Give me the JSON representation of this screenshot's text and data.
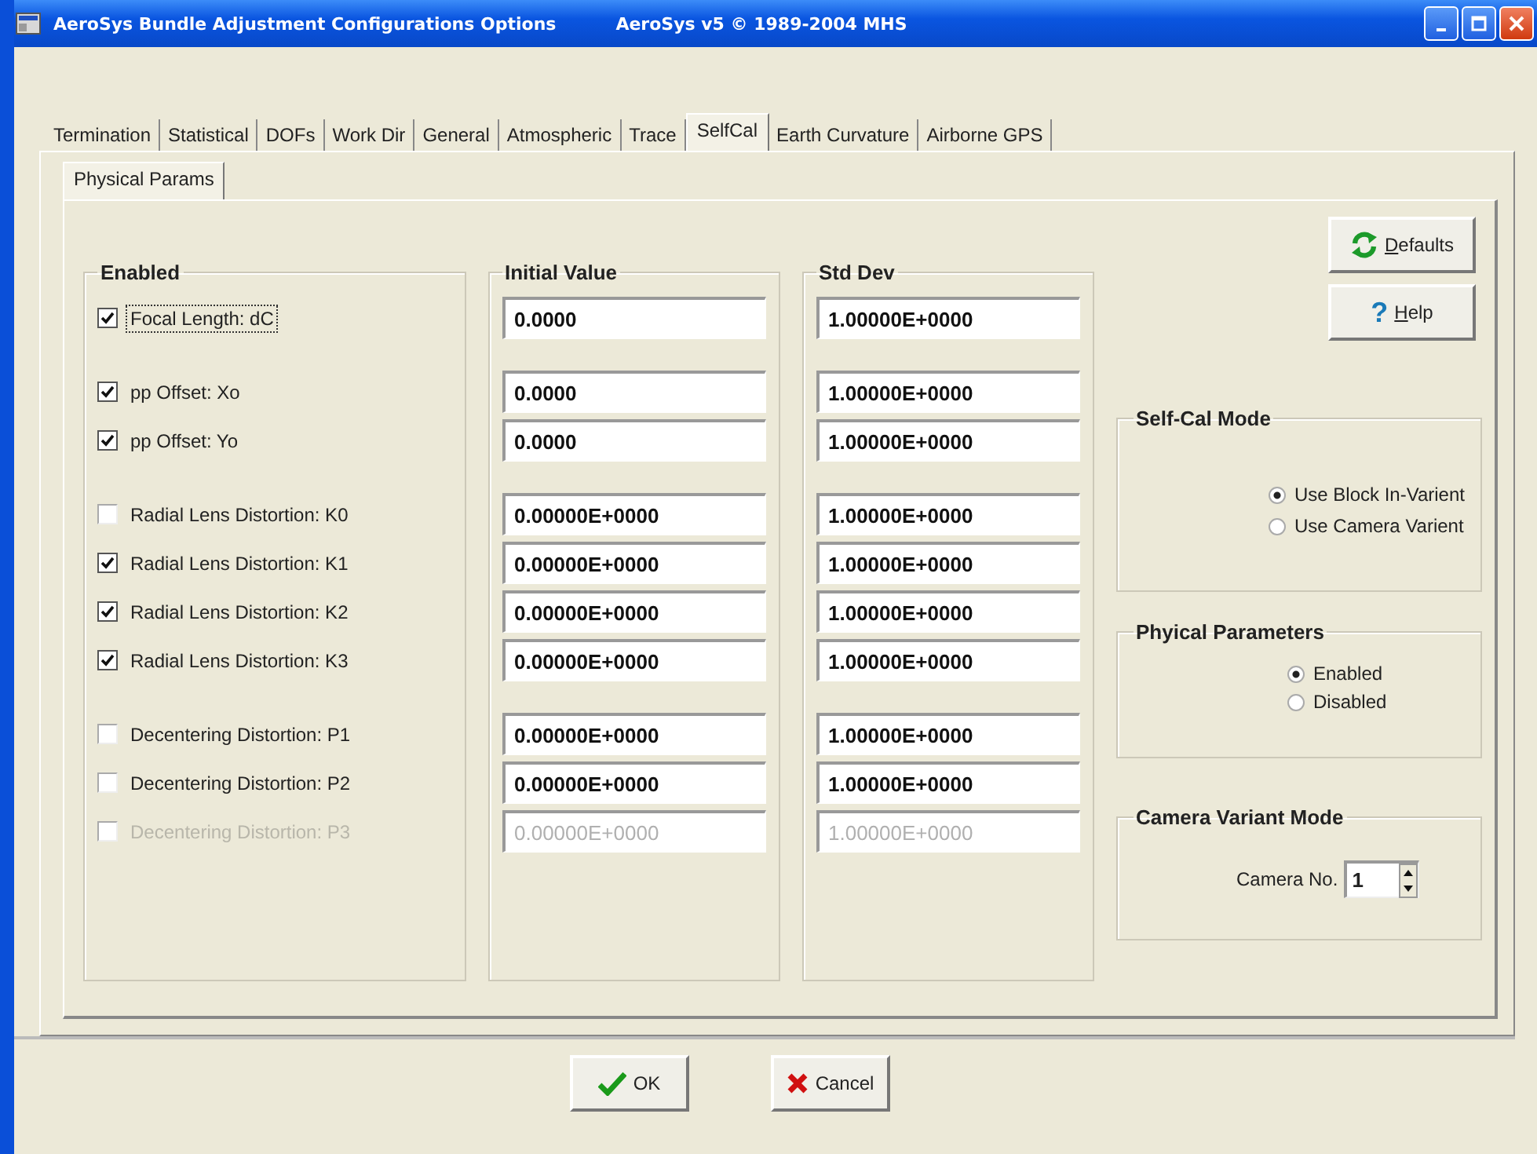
{
  "window": {
    "title": "AeroSys Bundle Adjustment Configurations Options",
    "subtitle": "AeroSys v5 © 1989-2004 MHS"
  },
  "tabs": [
    {
      "label": "Termination",
      "selected": false
    },
    {
      "label": "Statistical",
      "selected": false
    },
    {
      "label": "DOFs",
      "selected": false
    },
    {
      "label": "Work Dir",
      "selected": false
    },
    {
      "label": "General",
      "selected": false
    },
    {
      "label": "Atmospheric",
      "selected": false
    },
    {
      "label": "Trace",
      "selected": false
    },
    {
      "label": "SelfCal",
      "selected": true
    },
    {
      "label": "Earth Curvature",
      "selected": false
    },
    {
      "label": "Airborne GPS",
      "selected": false
    }
  ],
  "subtabs": [
    {
      "label": "Physical Params",
      "selected": true
    }
  ],
  "columns": {
    "enabled": "Enabled",
    "initial_value": "Initial Value",
    "std_dev": "Std Dev"
  },
  "parameter_groups": [
    {
      "parameters": [
        {
          "label": "Focal Length: dC",
          "checked": true,
          "disabled": false,
          "focused": true,
          "initial_value": "0.0000",
          "std_dev": "1.00000E+0000"
        }
      ]
    },
    {
      "parameters": [
        {
          "label": "pp Offset: Xo",
          "checked": true,
          "disabled": false,
          "focused": false,
          "initial_value": "0.0000",
          "std_dev": "1.00000E+0000"
        },
        {
          "label": "pp Offset: Yo",
          "checked": true,
          "disabled": false,
          "focused": false,
          "initial_value": "0.0000",
          "std_dev": "1.00000E+0000"
        }
      ]
    },
    {
      "parameters": [
        {
          "label": "Radial Lens Distortion: K0",
          "checked": false,
          "disabled": false,
          "focused": false,
          "initial_value": "0.00000E+0000",
          "std_dev": "1.00000E+0000"
        },
        {
          "label": "Radial Lens Distortion: K1",
          "checked": true,
          "disabled": false,
          "focused": false,
          "initial_value": "0.00000E+0000",
          "std_dev": "1.00000E+0000"
        },
        {
          "label": "Radial Lens Distortion: K2",
          "checked": true,
          "disabled": false,
          "focused": false,
          "initial_value": "0.00000E+0000",
          "std_dev": "1.00000E+0000"
        },
        {
          "label": "Radial Lens Distortion: K3",
          "checked": true,
          "disabled": false,
          "focused": false,
          "initial_value": "0.00000E+0000",
          "std_dev": "1.00000E+0000"
        }
      ]
    },
    {
      "parameters": [
        {
          "label": "Decentering Distortion: P1",
          "checked": false,
          "disabled": false,
          "focused": false,
          "initial_value": "0.00000E+0000",
          "std_dev": "1.00000E+0000"
        },
        {
          "label": "Decentering Distortion: P2",
          "checked": false,
          "disabled": false,
          "focused": false,
          "initial_value": "0.00000E+0000",
          "std_dev": "1.00000E+0000"
        },
        {
          "label": "Decentering Distortion: P3",
          "checked": false,
          "disabled": true,
          "focused": false,
          "initial_value": "0.00000E+0000",
          "std_dev": "1.00000E+0000"
        }
      ]
    }
  ],
  "side_buttons": [
    {
      "label": "Defaults",
      "kind": "defaults"
    },
    {
      "label": "Help",
      "kind": "help",
      "icon_text": "?"
    }
  ],
  "self_cal_mode": {
    "title": "Self-Cal Mode",
    "options": [
      {
        "label": "Use Block In-Varient",
        "selected": true
      },
      {
        "label": "Use Camera Varient",
        "selected": false
      }
    ]
  },
  "physical_parameters": {
    "title": "Phyical Parameters",
    "options": [
      {
        "label": "Enabled",
        "selected": true
      },
      {
        "label": "Disabled",
        "selected": false
      }
    ]
  },
  "camera_variant_mode": {
    "title": "Camera Variant Mode",
    "label": "Camera No.",
    "value": "1"
  },
  "buttons": [
    {
      "label": "OK",
      "kind": "ok"
    },
    {
      "label": "Cancel",
      "kind": "cancel"
    }
  ]
}
